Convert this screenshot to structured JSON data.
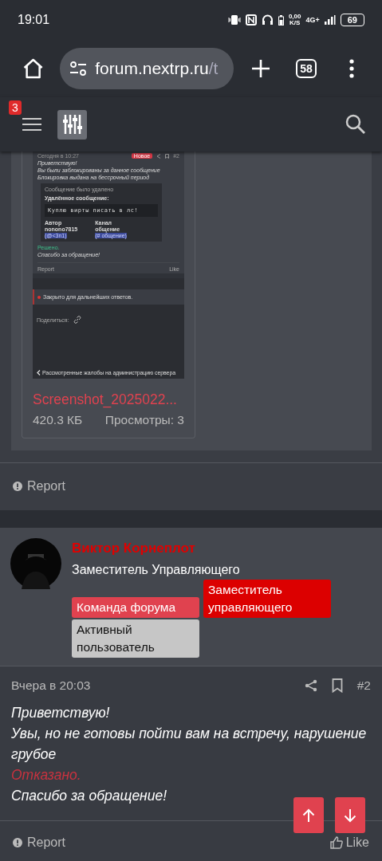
{
  "status_bar": {
    "time": "19:01",
    "net_speed": "0,00",
    "net_unit": "K/S",
    "network": "4G+",
    "battery": "69"
  },
  "browser": {
    "url_host": "forum.nextrp.ru",
    "url_path": "/t",
    "tab_count": "58"
  },
  "forum_header": {
    "notification_count": "3"
  },
  "attachment_post": {
    "attachment": {
      "preview": {
        "date": "Сегодня в 10:27",
        "badge": "Новое",
        "number": "#2",
        "lines": [
          "Приветствую!",
          "Вы были заблокированы за данное сообщение",
          "Блокировка выдана на бессрочный период"
        ],
        "quote": {
          "title": "Сообщение было удалено",
          "label": "Удалённое сообщение:",
          "code": "Куплю вирты писать в лс!",
          "fields": [
            {
              "name": "Автор",
              "value": "nonono7815",
              "tag": "(@<3n1)"
            },
            {
              "name": "Канал",
              "value": "общение",
              "tag": "(# общение)"
            }
          ]
        },
        "verdict": "Решено.",
        "thanks": "Спасибо за обращение!",
        "report": "Report",
        "like": "Like",
        "closed": "Закрыто для дальнейших ответов.",
        "share": "Поделиться:",
        "breadcrumb": "Рассмотренные жалобы на администрацию сервера"
      },
      "filename": "Screenshot_2025022...",
      "size": "420.3 КБ",
      "views": "Просмотры: 3"
    },
    "report": "Report"
  },
  "post": {
    "author": "Виктор Корнеплот",
    "title": "Заместитель Управляющего",
    "banners": [
      {
        "label": "Команда форума",
        "color": "#e0424f"
      },
      {
        "label": "Заместитель управляющего",
        "color": "#dc0000"
      },
      {
        "label": "Активный пользователь",
        "color": "#c6c6c6"
      }
    ],
    "date": "Вчера в 20:03",
    "number": "#2",
    "body": [
      {
        "kind": "text",
        "text": "Приветствую!"
      },
      {
        "kind": "text",
        "text": "Увы, но не готовы пойти вам на встречу, нарушение грубое"
      },
      {
        "kind": "verdict",
        "text": "Отказано."
      },
      {
        "kind": "text",
        "text": "Спасибо за обращение!"
      }
    ],
    "report": "Report",
    "like": "Like"
  }
}
